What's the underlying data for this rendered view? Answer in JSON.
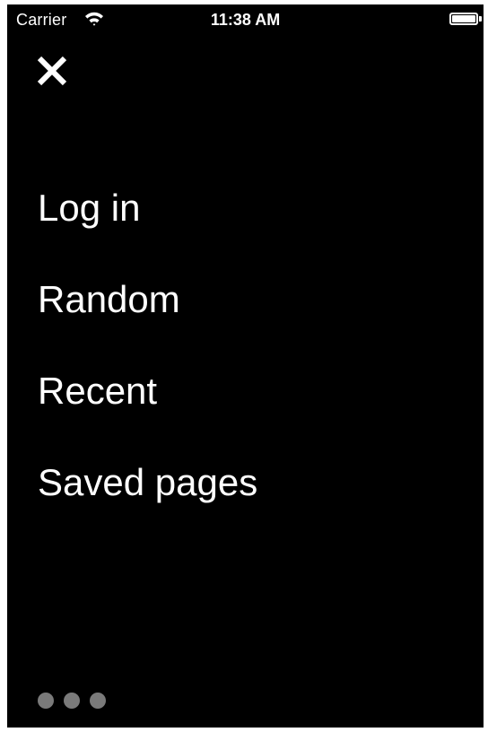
{
  "status_bar": {
    "carrier": "Carrier",
    "time": "11:38 AM",
    "wifi_icon": "wifi-icon",
    "battery_icon": "battery-icon",
    "battery_level": 1.0
  },
  "close_button": {
    "icon": "close-icon",
    "color": "#ffffff"
  },
  "menu": {
    "items": [
      {
        "label": "Log in"
      },
      {
        "label": "Random"
      },
      {
        "label": "Recent"
      },
      {
        "label": "Saved pages"
      }
    ]
  },
  "page_indicator": {
    "count": 3,
    "dot_color": "#7a7a7a"
  },
  "colors": {
    "background": "#000000",
    "text": "#ffffff"
  }
}
